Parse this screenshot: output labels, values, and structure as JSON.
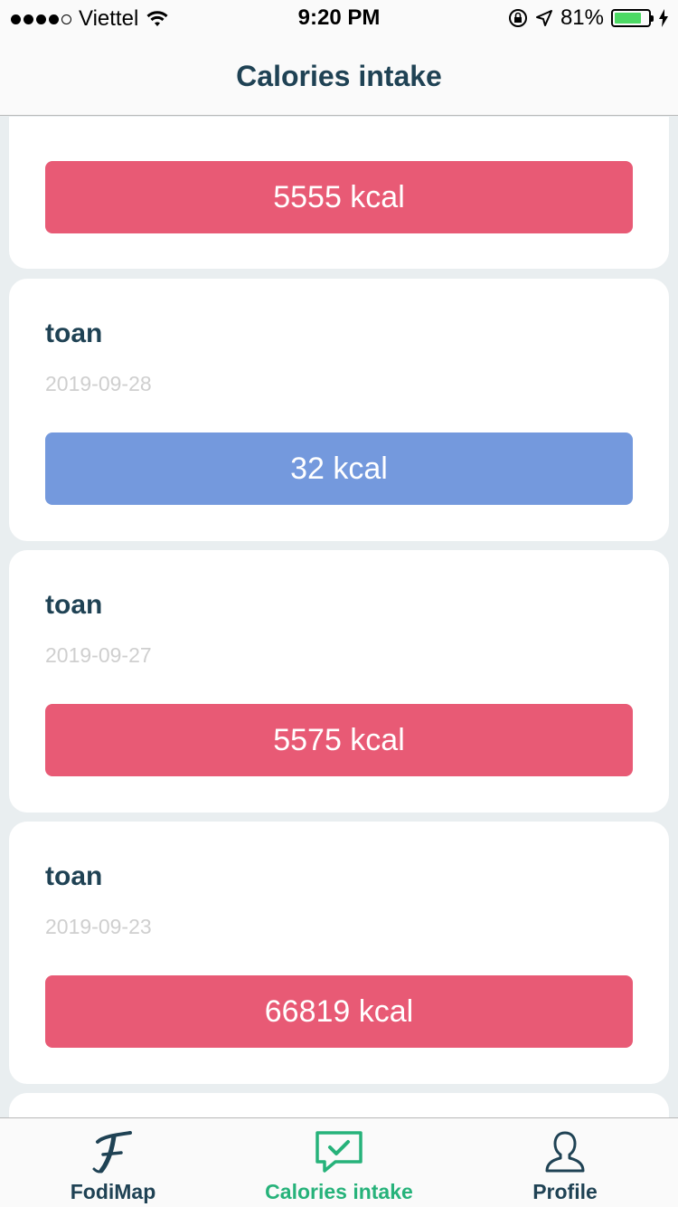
{
  "status": {
    "carrier": "Viettel",
    "time": "9:20 PM",
    "battery_text": "81%",
    "battery_level": 0.81
  },
  "header": {
    "title": "Calories intake"
  },
  "entries": [
    {
      "name": "",
      "date": "",
      "kcal": "5555 kcal",
      "color": "#e85a75"
    },
    {
      "name": "toan",
      "date": "2019-09-28",
      "kcal": "32 kcal",
      "color": "#7499dd"
    },
    {
      "name": "toan",
      "date": "2019-09-27",
      "kcal": "5575 kcal",
      "color": "#e85a75"
    },
    {
      "name": "toan",
      "date": "2019-09-23",
      "kcal": "66819 kcal",
      "color": "#e85a75"
    }
  ],
  "tabs": [
    {
      "label": "FodiMap",
      "icon": "fodimap-logo-icon",
      "active": false
    },
    {
      "label": "Calories intake",
      "icon": "chat-check-icon",
      "active": true
    },
    {
      "label": "Profile",
      "icon": "person-icon",
      "active": false
    }
  ],
  "colors": {
    "accent": "#26b27a",
    "text": "#1f4254",
    "high": "#e85a75",
    "low": "#7499dd"
  }
}
